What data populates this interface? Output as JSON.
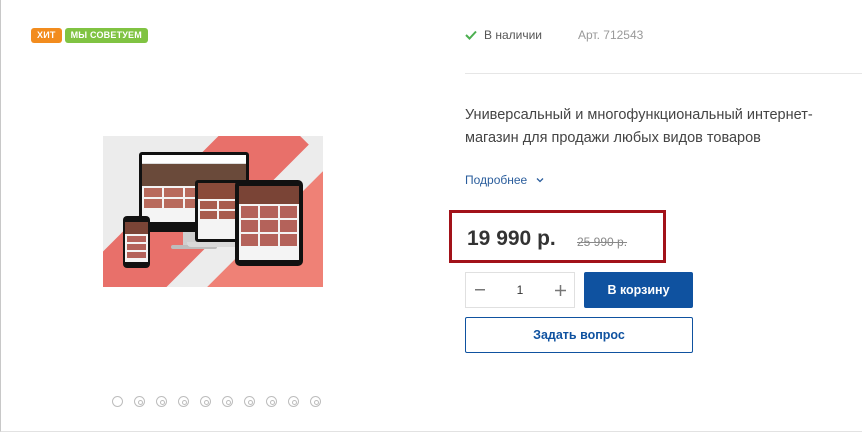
{
  "badges": [
    {
      "label": "ХИТ",
      "color": "#f28c1e"
    },
    {
      "label": "МЫ СОВЕТУЕМ",
      "color": "#80c342"
    }
  ],
  "stock": {
    "label": "В наличии",
    "icon": "check-icon",
    "color": "#4caf50"
  },
  "article": "Арт. 712543",
  "description": "Универсальный и многофункциональный интернет-магазин для продажи любых видов товаров",
  "more_link": {
    "label": "Подробнее",
    "icon": "chevron-down-icon"
  },
  "price": {
    "current": "19 990 р.",
    "old": "25 990 р.",
    "highlight_color": "#a21219"
  },
  "quantity": {
    "value": "1",
    "minus_icon": "minus-icon",
    "plus_icon": "plus-icon"
  },
  "buttons": {
    "cart": "В корзину",
    "ask": "Задать вопрос",
    "accent": "#0f52a0"
  },
  "gallery": {
    "dot_count": 10
  }
}
